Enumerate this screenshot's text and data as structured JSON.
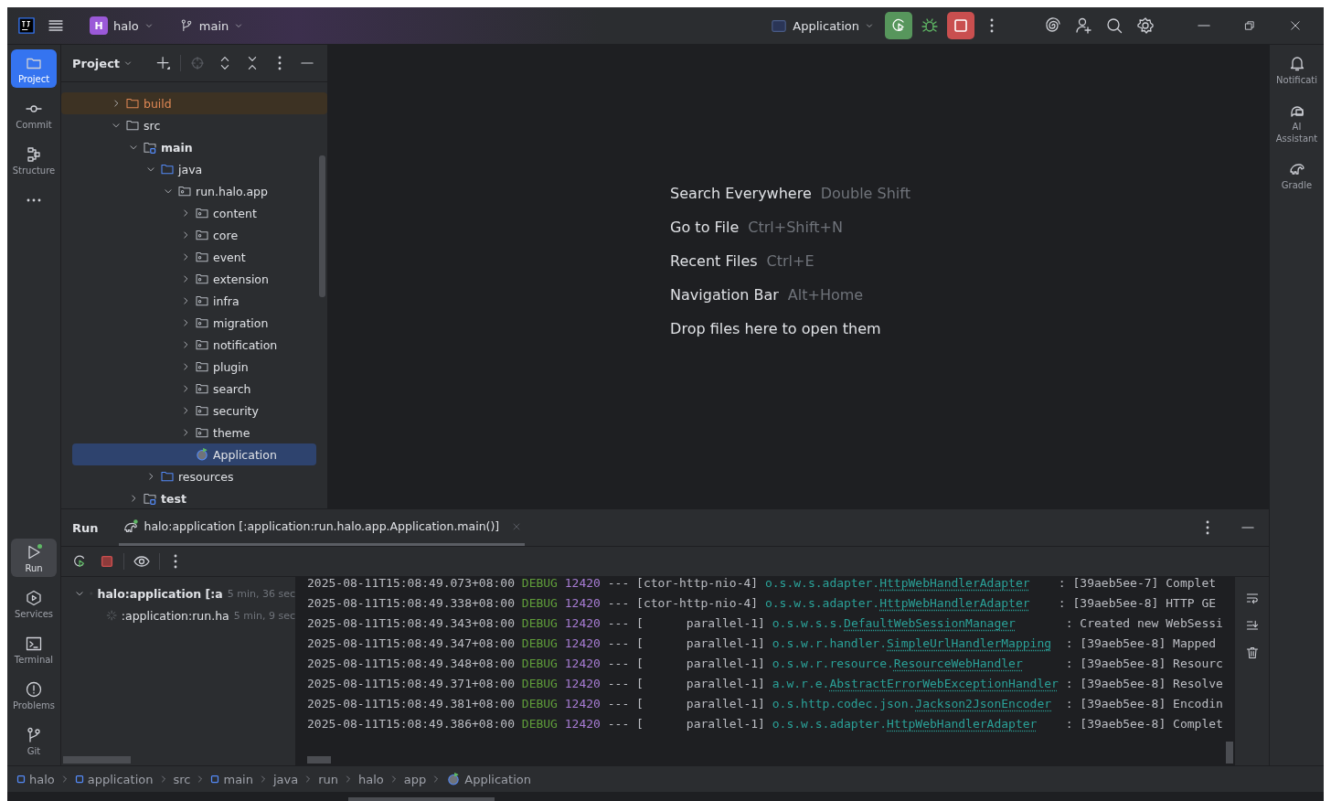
{
  "title_bar": {
    "project_badge": "H",
    "project": "halo",
    "branch": "main",
    "run_config": "Application"
  },
  "left_tools": [
    {
      "label": "Project",
      "kind": "folder",
      "selected": true
    },
    {
      "label": "Commit",
      "kind": "commit",
      "selected": false
    },
    {
      "label": "Structure",
      "kind": "structure",
      "selected": false
    }
  ],
  "bottom_tools": [
    {
      "label": "Run",
      "kind": "run",
      "selected": true
    },
    {
      "label": "Services",
      "kind": "services",
      "selected": false
    },
    {
      "label": "Terminal",
      "kind": "terminal",
      "selected": false
    },
    {
      "label": "Problems",
      "kind": "problems",
      "selected": false
    },
    {
      "label": "Git",
      "kind": "git",
      "selected": false
    }
  ],
  "right_tools": [
    {
      "label": "Notificati",
      "kind": "bell"
    },
    {
      "label": "AI Assistant",
      "kind": "ai"
    },
    {
      "label": "Gradle",
      "kind": "gradle"
    }
  ],
  "project_panel": {
    "title": "Project",
    "tree": [
      {
        "label": "build",
        "kind": "excluded",
        "expanded": false,
        "selected": false
      },
      {
        "label": "src",
        "kind": "folder",
        "expanded": true,
        "selected": false,
        "children": [
          {
            "label": "main",
            "kind": "module",
            "expanded": true,
            "selected": false,
            "children": [
              {
                "label": "java",
                "kind": "source",
                "expanded": true,
                "selected": false,
                "children": [
                  {
                    "label": "run.halo.app",
                    "kind": "package",
                    "expanded": true,
                    "selected": false,
                    "children": [
                      {
                        "label": "content",
                        "kind": "package",
                        "expanded": false,
                        "selected": false
                      },
                      {
                        "label": "core",
                        "kind": "package",
                        "expanded": false,
                        "selected": false
                      },
                      {
                        "label": "event",
                        "kind": "package",
                        "expanded": false,
                        "selected": false
                      },
                      {
                        "label": "extension",
                        "kind": "package",
                        "expanded": false,
                        "selected": false
                      },
                      {
                        "label": "infra",
                        "kind": "package",
                        "expanded": false,
                        "selected": false
                      },
                      {
                        "label": "migration",
                        "kind": "package",
                        "expanded": false,
                        "selected": false
                      },
                      {
                        "label": "notification",
                        "kind": "package",
                        "expanded": false,
                        "selected": false
                      },
                      {
                        "label": "plugin",
                        "kind": "package",
                        "expanded": false,
                        "selected": false
                      },
                      {
                        "label": "search",
                        "kind": "package",
                        "expanded": false,
                        "selected": false
                      },
                      {
                        "label": "security",
                        "kind": "package",
                        "expanded": false,
                        "selected": false
                      },
                      {
                        "label": "theme",
                        "kind": "package",
                        "expanded": false,
                        "selected": false
                      },
                      {
                        "label": "Application",
                        "kind": "class",
                        "selected": true
                      }
                    ]
                  }
                ]
              },
              {
                "label": "resources",
                "kind": "source",
                "expanded": false,
                "selected": false
              }
            ]
          },
          {
            "label": "test",
            "kind": "module",
            "expanded": false,
            "selected": false
          }
        ]
      }
    ]
  },
  "editor_hints": [
    {
      "action": "Search Everywhere",
      "shortcut": "Double Shift"
    },
    {
      "action": "Go to File",
      "shortcut": "Ctrl+Shift+N"
    },
    {
      "action": "Recent Files",
      "shortcut": "Ctrl+E"
    },
    {
      "action": "Navigation Bar",
      "shortcut": "Alt+Home"
    },
    {
      "action": "Drop files here to open them"
    }
  ],
  "run_panel": {
    "title": "Run",
    "tab": "halo:application [:application:run.halo.app.Application.main()]",
    "tree": [
      {
        "label": "halo:application [:a",
        "time": "5 min, 36 sec",
        "expanded": true,
        "children": [
          {
            "label": ":application:run.ha",
            "time": "5 min, 9 sec"
          }
        ]
      }
    ],
    "log": [
      {
        "timestamp": "2025-08-11T15:08:49.073+08:00",
        "level": "DEBUG",
        "pid": "12420",
        "sep": "---",
        "thread": "[ctor-http-nio-4]",
        "logger_package": "o.s.w.s.adapter.",
        "logger_class": "HttpWebHandlerAdapter",
        "message": ": [39aeb5ee-7] Complet"
      },
      {
        "timestamp": "2025-08-11T15:08:49.338+08:00",
        "level": "DEBUG",
        "pid": "12420",
        "sep": "---",
        "thread": "[ctor-http-nio-4]",
        "logger_package": "o.s.w.s.adapter.",
        "logger_class": "HttpWebHandlerAdapter",
        "message": ": [39aeb5ee-8] HTTP GE"
      },
      {
        "timestamp": "2025-08-11T15:08:49.343+08:00",
        "level": "DEBUG",
        "pid": "12420",
        "sep": "---",
        "thread": "[      parallel-1]",
        "logger_package": "o.s.w.s.s.",
        "logger_class": "DefaultWebSessionManager",
        "message": ": Created new WebSessi"
      },
      {
        "timestamp": "2025-08-11T15:08:49.347+08:00",
        "level": "DEBUG",
        "pid": "12420",
        "sep": "---",
        "thread": "[      parallel-1]",
        "logger_package": "o.s.w.r.handler.",
        "logger_class": "SimpleUrlHandlerMapping",
        "message": ": [39aeb5ee-8] Mapped"
      },
      {
        "timestamp": "2025-08-11T15:08:49.348+08:00",
        "level": "DEBUG",
        "pid": "12420",
        "sep": "---",
        "thread": "[      parallel-1]",
        "logger_package": "o.s.w.r.resource.",
        "logger_class": "ResourceWebHandler",
        "message": ": [39aeb5ee-8] Resourc"
      },
      {
        "timestamp": "2025-08-11T15:08:49.371+08:00",
        "level": "DEBUG",
        "pid": "12420",
        "sep": "---",
        "thread": "[      parallel-1]",
        "logger_package": "a.w.r.e.",
        "logger_class": "AbstractErrorWebExceptionHandler",
        "message": ": [39aeb5ee-8] Resolve"
      },
      {
        "timestamp": "2025-08-11T15:08:49.381+08:00",
        "level": "DEBUG",
        "pid": "12420",
        "sep": "---",
        "thread": "[      parallel-1]",
        "logger_package": "o.s.http.codec.json.",
        "logger_class": "Jackson2JsonEncoder",
        "message": ": [39aeb5ee-8] Encodin"
      },
      {
        "timestamp": "2025-08-11T15:08:49.386+08:00",
        "level": "DEBUG",
        "pid": "12420",
        "sep": "---",
        "thread": "[      parallel-1]",
        "logger_package": "o.s.w.s.adapter.",
        "logger_class": "HttpWebHandlerAdapter",
        "message": ": [39aeb5ee-8] Complet"
      }
    ]
  },
  "breadcrumbs": [
    {
      "label": "halo",
      "kind": "module"
    },
    {
      "label": "application",
      "kind": "module"
    },
    {
      "label": "src",
      "kind": "folder"
    },
    {
      "label": "main",
      "kind": "module"
    },
    {
      "label": "java",
      "kind": "folder"
    },
    {
      "label": "run",
      "kind": "folder"
    },
    {
      "label": "halo",
      "kind": "folder"
    },
    {
      "label": "app",
      "kind": "folder"
    },
    {
      "label": "Application",
      "kind": "class"
    }
  ]
}
